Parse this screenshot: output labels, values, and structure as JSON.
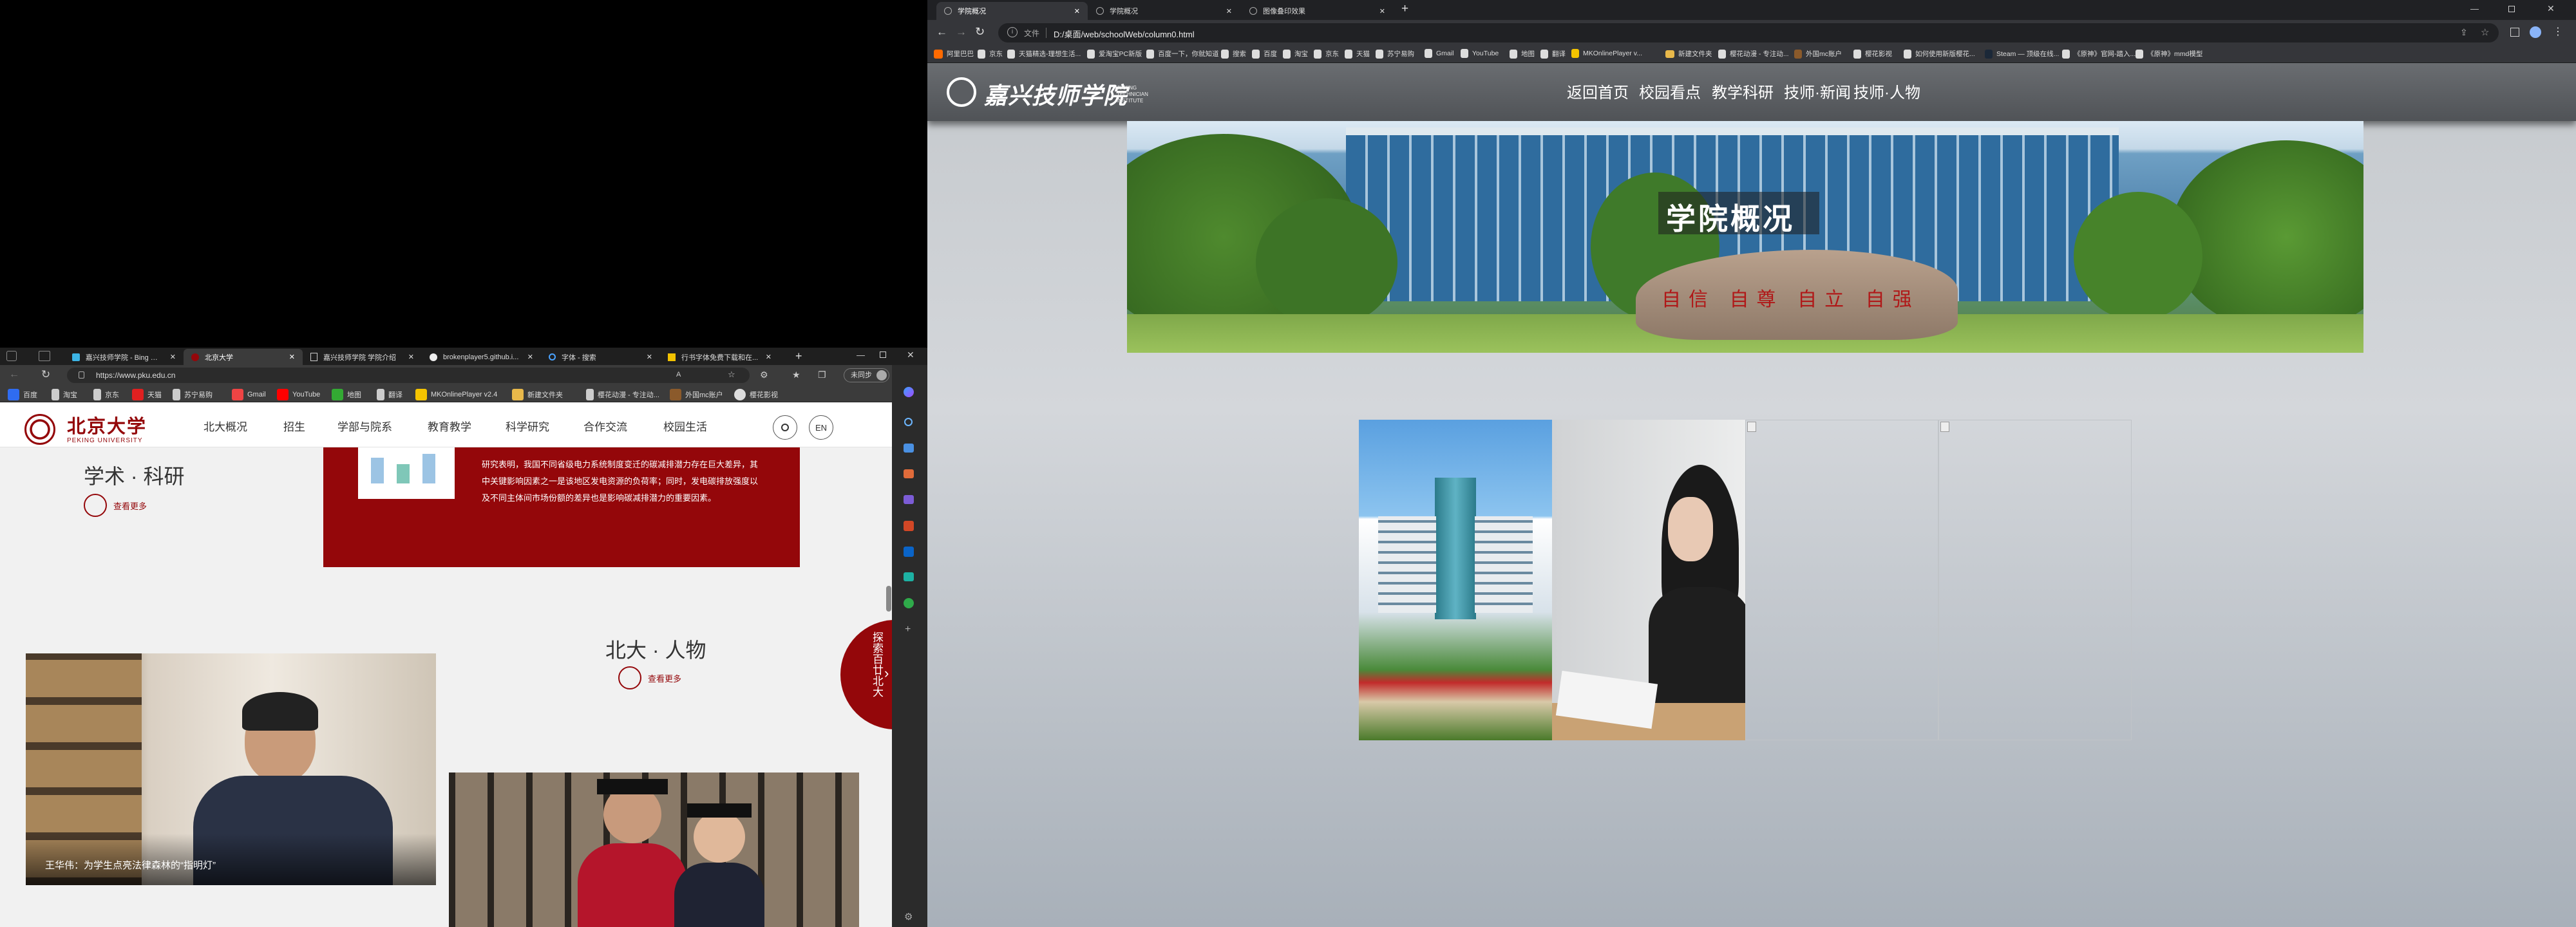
{
  "left": {
    "tabs": [
      {
        "label": "嘉兴技师学院 - Bing 搜索"
      },
      {
        "label": "北京大学"
      },
      {
        "label": "嘉兴技师学院 学院介绍"
      },
      {
        "label": "brokenplayer5.github.i..."
      },
      {
        "label": "字体 - 搜索"
      },
      {
        "label": "行书字体免费下载和在..."
      }
    ],
    "address": "https://www.pku.edu.cn",
    "profile": "未同步",
    "bookmarks": [
      "百度",
      "淘宝",
      "京东",
      "天猫",
      "苏宁易购",
      "Gmail",
      "YouTube",
      "地图",
      "翻译",
      "MKOnlinePlayer v2.4",
      "新建文件夹",
      "樱花动漫 - 专注动...",
      "外国mc账户",
      "樱花影视"
    ],
    "site": {
      "logo_cn": "北京大学",
      "logo_en": "PEKING UNIVERSITY",
      "nav": [
        "北大概况",
        "招生",
        "学部与院系",
        "教育教学",
        "科学研究",
        "合作交流",
        "校园生活"
      ],
      "lang": "EN",
      "research_title": "学术 · 科研",
      "more": "查看更多",
      "research_text": "研究表明，我国不同省级电力系统制度变迁的碳减排潜力存在巨大差异，其中关键影响因素之一是该地区发电资源的负荷率；同时，发电碳排放强度以及不同主体间市场份额的差异也是影响碳减排潜力的重要因素。",
      "people_title": "北大 · 人物",
      "people_more": "查看更多",
      "photo_caption": "王华伟：为学生点亮法律森林的“指明灯”",
      "explore": "探索百廿北大"
    }
  },
  "right": {
    "tabs": [
      {
        "label": "学院概况"
      },
      {
        "label": "学院概况"
      },
      {
        "label": "图像叠印效果"
      }
    ],
    "address_prefix": "文件",
    "address": "D:/桌面/web/schoolWeb/column0.html",
    "bookmarks": [
      "阿里巴巴",
      "京东",
      "天猫精选-理想生活...",
      "爱淘宝PC新版",
      "百度一下，你就知道",
      "搜索",
      "百度",
      "淘宝",
      "京东",
      "天猫",
      "苏宁易购",
      "Gmail",
      "YouTube",
      "地图",
      "翻译",
      "MKOnlinePlayer v...",
      "新建文件夹",
      "樱花动漫 - 专注动...",
      "外国mc账户",
      "樱花影视",
      "如何使用新版樱花...",
      "Steam — 顶级在线...",
      "《原神》官网-踏入...",
      "《原神》mmd模型"
    ],
    "site": {
      "logo_cn": "嘉兴技师学院",
      "logo_en": "JIAXING TECHNICIAN INSTITUTE",
      "nav": [
        "返回首页",
        "校园看点",
        "教学科研",
        "技师·新闻",
        "技师·人物"
      ],
      "banner_title": "学院概况",
      "stone_text": "自信 自尊 自立 自强"
    }
  },
  "colors": {
    "pku_red": "#94070a",
    "dark_chrome": "#202124",
    "jx_header": "#5a5d61"
  }
}
